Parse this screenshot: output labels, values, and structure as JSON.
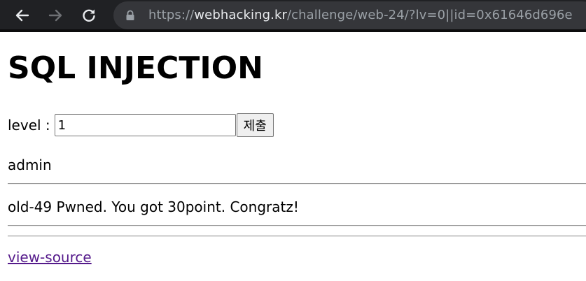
{
  "browser": {
    "url_prefix": "https://",
    "url_host": "webhacking.kr",
    "url_path": "/challenge/web-24/?lv=0||id=0x61646d696e"
  },
  "page": {
    "title": "SQL INJECTION",
    "level_label": "level :",
    "level_value": "1",
    "submit_label": "제출",
    "result_name": "admin",
    "message": "old-49 Pwned. You got 30point. Congratz!",
    "link_label": "view-source"
  },
  "colors": {
    "toolbar": "#202124",
    "omnibox": "#35363a",
    "url_dim": "#9aa0a6",
    "url_host": "#e8eaed",
    "visited_link": "#551a8b"
  },
  "icons": {
    "back": "back-arrow-icon",
    "forward": "forward-arrow-icon",
    "reload": "reload-icon",
    "lock": "lock-icon"
  }
}
